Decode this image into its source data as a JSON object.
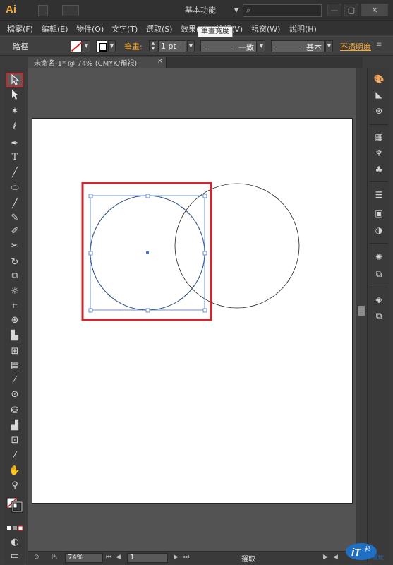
{
  "app": {
    "logo": "Ai",
    "workspace": "基本功能",
    "window_controls": [
      "—",
      "▢",
      "✕"
    ]
  },
  "menu": [
    "檔案(F)",
    "編輯(E)",
    "物件(O)",
    "文字(T)",
    "選取(S)",
    "效果(C)",
    "檢視(V)",
    "視窗(W)",
    "說明(H)"
  ],
  "tooltip": "筆畫寬度",
  "controlbar": {
    "selection_label": "路徑",
    "stroke_label": "筆畫:",
    "stroke_weight": "1 pt",
    "profile_label": "一致",
    "brush_label": "基本",
    "opacity_link": "不透明度",
    "panel_menu_icon": "≡"
  },
  "document": {
    "tab_title": "未命名-1* @ 74% (CMYK/預視)",
    "close": "×"
  },
  "status": {
    "zoom": "74%",
    "page": "1",
    "current_tool": "選取"
  },
  "colors": {
    "highlight": "#c8282e",
    "accent": "#f4a93b",
    "selection_blue": "#4a78c8"
  },
  "tools": [
    "selection-icon",
    "direct-selection-icon",
    "magic-wand-icon",
    "lasso-icon",
    "pen-icon",
    "type-icon",
    "line-icon",
    "ellipse-icon",
    "paintbrush-icon",
    "pencil-icon",
    "blob-brush-icon",
    "scissors-icon",
    "rotate-icon",
    "scale-icon",
    "warp-icon",
    "free-transform-icon",
    "shape-builder-icon",
    "perspective-icon",
    "mesh-icon",
    "gradient-icon",
    "eyedropper-icon",
    "blend-icon",
    "symbol-sprayer-icon",
    "graph-icon",
    "artboard-icon",
    "slice-icon",
    "hand-icon",
    "zoom-icon"
  ],
  "panels": [
    "color-icon",
    "color-guide-icon",
    "kuler-icon",
    "swatches-icon",
    "brushes-icon",
    "symbols-icon",
    "stroke-icon",
    "gradient-panel-icon",
    "transparency-icon",
    "appearance-icon",
    "graphic-styles-icon",
    "layers-icon",
    "artboards-icon"
  ]
}
